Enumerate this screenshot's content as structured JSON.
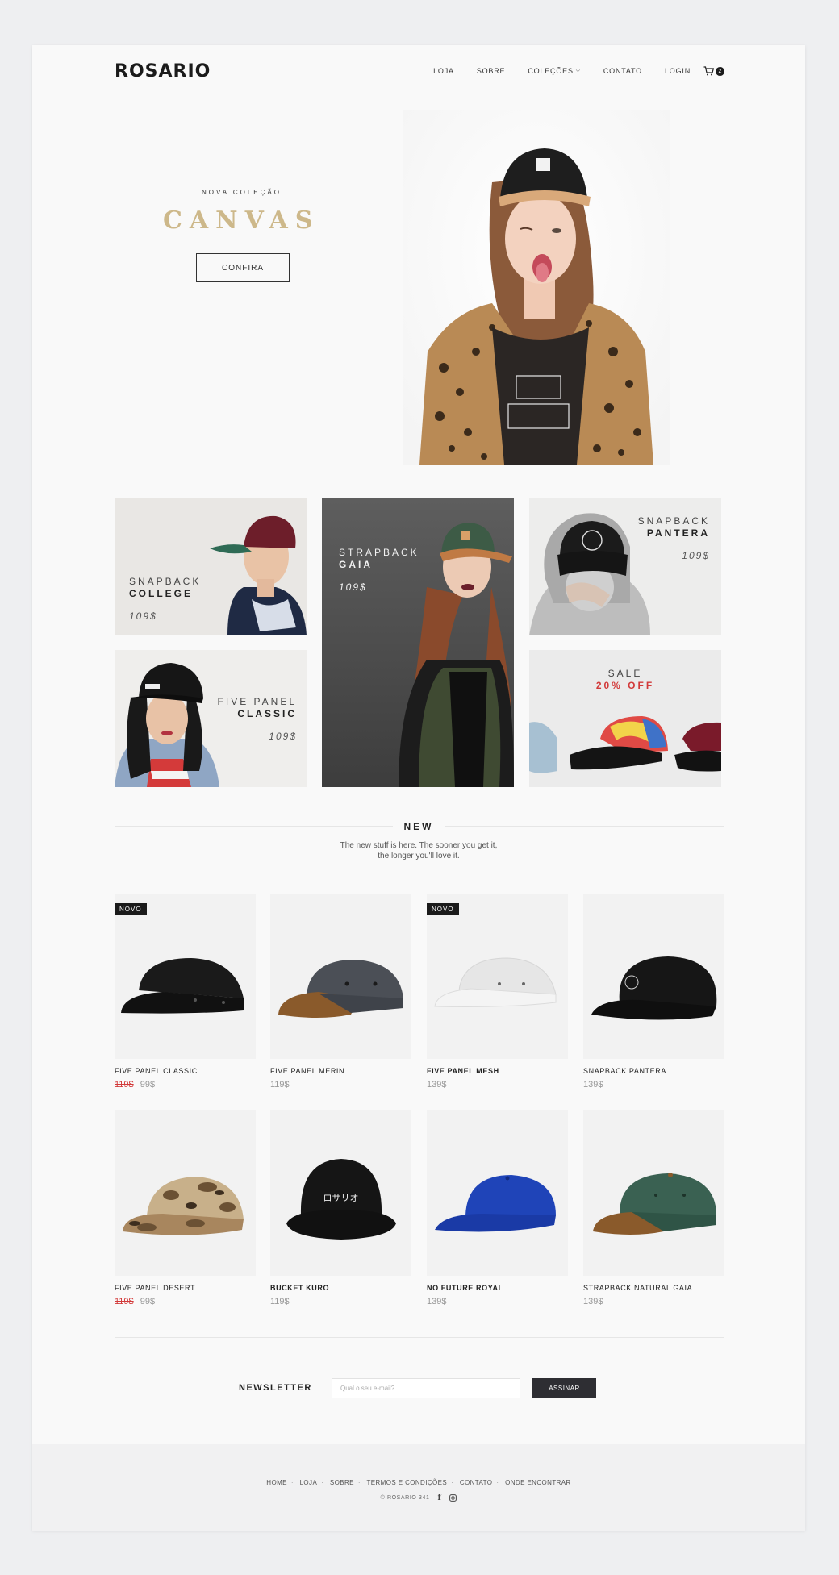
{
  "header": {
    "logo": "ROSARIO",
    "nav": [
      "LOJA",
      "SOBRE",
      "COLEÇÕES",
      "CONTATO",
      "LOGIN"
    ],
    "cart_count": "2"
  },
  "hero": {
    "subtitle": "NOVA COLEÇÃO",
    "title": "CANVAS",
    "cta": "CONFIRA"
  },
  "promos": {
    "college": {
      "line1": "SNAPBACK",
      "line2": "COLLEGE",
      "price": "109$"
    },
    "gaia": {
      "line1": "STRAPBACK",
      "line2": "GAIA",
      "price": "109$"
    },
    "pantera": {
      "line1": "SNAPBACK",
      "line2": "PANTERA",
      "price": "109$"
    },
    "classic": {
      "line1": "FIVE PANEL",
      "line2": "CLASSIC",
      "price": "109$"
    },
    "sale": {
      "line1": "SALE",
      "line2": "20% OFF"
    }
  },
  "new_section": {
    "title": "NEW",
    "desc1": "The new stuff is here. The sooner you get it,",
    "desc2": "the longer you'll love it."
  },
  "products": [
    {
      "name": "FIVE PANEL CLASSIC",
      "old": "119$",
      "price": "99$",
      "badge": "NOVO"
    },
    {
      "name": "FIVE PANEL MERIN",
      "price": "119$"
    },
    {
      "name": "FIVE PANEL MESH",
      "price": "139$",
      "badge": "NOVO"
    },
    {
      "name": "SNAPBACK PANTERA",
      "price": "139$"
    },
    {
      "name": "FIVE PANEL DESERT",
      "old": "119$",
      "price": "99$"
    },
    {
      "name": "BUCKET KURO",
      "price": "119$",
      "print": "ロサリオ"
    },
    {
      "name": "NO FUTURE ROYAL",
      "price": "139$"
    },
    {
      "name": "STRAPBACK NATURAL GAIA",
      "price": "139$"
    }
  ],
  "newsletter": {
    "label": "NEWSLETTER",
    "placeholder": "Qual o seu e-mail?",
    "button": "ASSINAR"
  },
  "footer": {
    "links": [
      "HOME",
      "LOJA",
      "SOBRE",
      "TERMOS E CONDIÇÕES",
      "CONTATO",
      "ONDE ENCONTRAR"
    ],
    "copyright": "© ROSARIO 341"
  },
  "colors": {
    "accent_gold": "#cdb88a",
    "sale_red": "#d23a3a",
    "dark": "#1b1b1b"
  }
}
